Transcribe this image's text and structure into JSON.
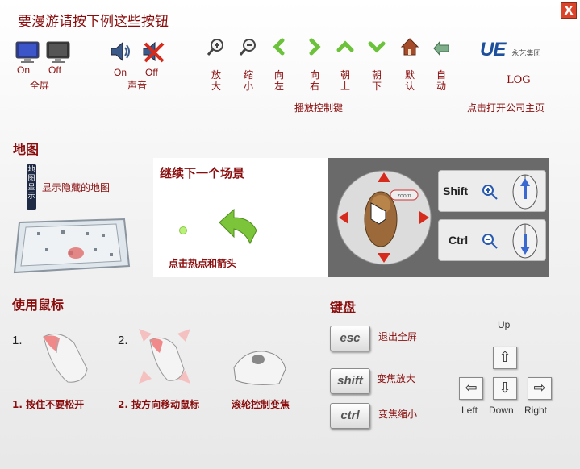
{
  "title": "要漫游请按下例这些按钮",
  "close_glyph": "X",
  "fullscreen": {
    "on": "On",
    "off": "Off",
    "label": "全屏"
  },
  "sound": {
    "on": "On",
    "off": "Off",
    "label": "声音"
  },
  "playback": {
    "buttons": [
      {
        "label": "放大",
        "icon": "zoom-in-icon"
      },
      {
        "label": "缩小",
        "icon": "zoom-out-icon"
      },
      {
        "label": "向左",
        "icon": "chevron-left-icon"
      },
      {
        "label": "向右",
        "icon": "chevron-right-icon"
      },
      {
        "label": "朝上",
        "icon": "chevron-up-icon"
      },
      {
        "label": "朝下",
        "icon": "chevron-down-icon"
      },
      {
        "label": "默认",
        "icon": "home-icon"
      },
      {
        "label": "自动",
        "icon": "auto-play-icon"
      }
    ],
    "caption": "播放控制键"
  },
  "logo": {
    "brand": "UE",
    "sub": "永艺集团",
    "label": "LOG",
    "caption": "点击打开公司主页"
  },
  "map": {
    "title": "地图",
    "toggle_label": "显示隐藏的地图",
    "badge": "地图显示"
  },
  "scene": {
    "title": "继续下一个场景",
    "caption": "点击热点和箭头"
  },
  "mouse_panel": {
    "zoom_tag": "zoom",
    "shift": "Shift",
    "ctrl": "Ctrl"
  },
  "use_mouse": {
    "title": "使用鼠标",
    "step1_num": "1.",
    "step2_num": "2.",
    "step1": "1. 按住不要松开",
    "step2": "2. 按方向移动鼠标",
    "wheel": "滚轮控制变焦"
  },
  "keyboard": {
    "title": "键盘",
    "keys": [
      {
        "key": "esc",
        "desc": "退出全屏"
      },
      {
        "key": "shift",
        "desc": "变焦放大"
      },
      {
        "key": "ctrl",
        "desc": "变焦缩小"
      }
    ],
    "arrows": {
      "up": "Up",
      "left": "Left",
      "down": "Down",
      "right": "Right"
    }
  },
  "colors": {
    "accent": "#8a0c0c",
    "green": "#5fb82d",
    "close_bg": "#d9442a"
  }
}
